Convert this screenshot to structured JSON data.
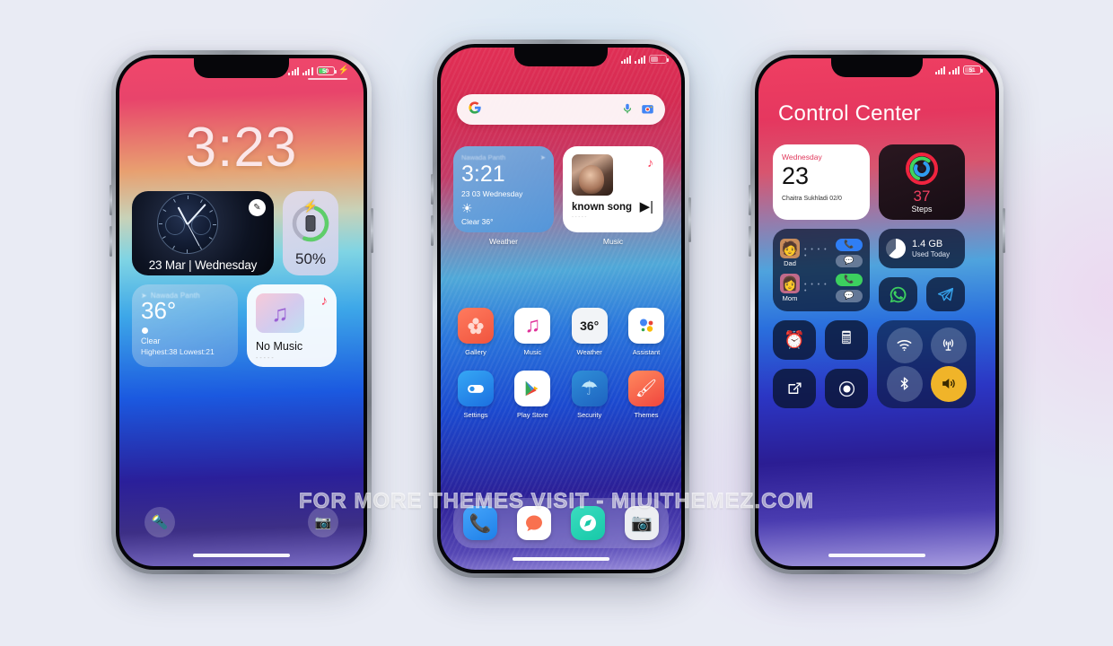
{
  "watermark": "FOR MORE THEMES VISIT - MIUITHEMEZ.COM",
  "phone1": {
    "name": "lock-screen",
    "status": {
      "battery_value": "50",
      "signal_icon": "signal-bars-icon",
      "battery_icon": "battery-icon",
      "charging_icon": "charging-bolt-icon"
    },
    "clock": "3:23",
    "clock_widget": {
      "date": "23 Mar | Wednesday",
      "edit_icon": "pencil-icon"
    },
    "battery_widget": {
      "percent": "50%",
      "icon": "phone-battery-icon",
      "bolt_icon": "charging-bolt-icon",
      "ring_percent": 50
    },
    "weather_widget": {
      "location": "Nawada Panth",
      "location_icon": "location-arrow-icon",
      "temp": "36°",
      "condition": "Clear",
      "high_low": "Highest:38 Lowest:21"
    },
    "music_widget": {
      "title": "No Music",
      "sub": "-----",
      "note_icon": "music-note-icon",
      "badge_icon": "apple-music-icon"
    },
    "actions": {
      "flashlight_icon": "flashlight-icon",
      "camera_icon": "camera-icon"
    }
  },
  "phone2": {
    "name": "home-screen",
    "status": {
      "signal_icon": "signal-bars-icon",
      "battery_icon": "battery-icon"
    },
    "search": {
      "g_icon": "google-g-icon",
      "mic_icon": "microphone-icon",
      "lens_icon": "google-lens-icon",
      "placeholder": ""
    },
    "weather_widget": {
      "label": "Weather",
      "location": "Nawada Panth",
      "location_icon": "location-arrow-icon",
      "time": "3:21",
      "date": "23 03 Wednesday",
      "sun_icon": "sun-icon",
      "condition": "Clear 36°"
    },
    "music_widget": {
      "label": "Music",
      "title": "known song",
      "sub": "-----",
      "badge_icon": "apple-music-icon",
      "play_icon": "play-next-icon"
    },
    "apps": [
      {
        "name": "Gallery",
        "icon": "gallery-flower-icon"
      },
      {
        "name": "Music",
        "icon": "music-note-icon"
      },
      {
        "name": "Weather",
        "icon": "weather-temp-icon",
        "value": "36°"
      },
      {
        "name": "Assistant",
        "icon": "google-assistant-icon"
      },
      {
        "name": "Settings",
        "icon": "settings-toggle-icon"
      },
      {
        "name": "Play Store",
        "icon": "play-store-icon"
      },
      {
        "name": "Security",
        "icon": "security-umbrella-icon"
      },
      {
        "name": "Themes",
        "icon": "themes-brush-icon"
      }
    ],
    "dock": [
      {
        "name": "Phone",
        "icon": "phone-handset-icon"
      },
      {
        "name": "Messages",
        "icon": "message-bubble-icon"
      },
      {
        "name": "Browser",
        "icon": "compass-icon"
      },
      {
        "name": "Camera",
        "icon": "camera-icon"
      }
    ]
  },
  "phone3": {
    "name": "control-center",
    "status": {
      "battery_value": "51",
      "signal_icon": "signal-bars-icon",
      "battery_icon": "battery-icon"
    },
    "title": "Control Center",
    "calendar": {
      "weekday": "Wednesday",
      "day": "23",
      "note": "Chaitra Sukhladi  02/0"
    },
    "steps": {
      "count": "37",
      "label": "Steps",
      "icon": "activity-rings-icon"
    },
    "contacts": [
      {
        "name": "Dad",
        "avatar_icon": "avatar-man-icon",
        "dots": "• • • • •",
        "call_icon": "phone-handset-icon",
        "call_color": "#2f7ef5",
        "message_icon": "message-bubble-icon"
      },
      {
        "name": "Mom",
        "avatar_icon": "avatar-woman-icon",
        "dots": "• • • • •",
        "call_icon": "phone-handset-icon",
        "call_color": "#3ccf5f",
        "message_icon": "message-bubble-icon"
      }
    ],
    "data_usage": {
      "amount": "1.4 GB",
      "label": "Used Today",
      "icon": "data-pie-icon"
    },
    "quick_apps": [
      {
        "name": "WhatsApp",
        "icon": "whatsapp-icon"
      },
      {
        "name": "Telegram",
        "icon": "telegram-icon"
      }
    ],
    "toggles_left": [
      {
        "name": "Alarm",
        "icon": "alarm-clock-icon"
      },
      {
        "name": "Calculator",
        "icon": "calculator-icon"
      },
      {
        "name": "Notes",
        "icon": "edit-note-icon"
      },
      {
        "name": "Recorder",
        "icon": "record-icon"
      }
    ],
    "toggles_right": [
      {
        "name": "Wi-Fi",
        "icon": "wifi-icon",
        "active": false
      },
      {
        "name": "Hotspot",
        "icon": "hotspot-icon",
        "active": false
      },
      {
        "name": "Bluetooth",
        "icon": "bluetooth-icon",
        "active": false
      },
      {
        "name": "Volume",
        "icon": "volume-icon",
        "active": true
      }
    ]
  }
}
